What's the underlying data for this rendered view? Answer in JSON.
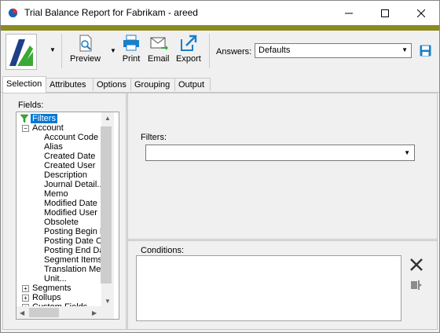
{
  "window": {
    "title": "Trial Balance Report for Fabrikam - areed",
    "controls": [
      "minimize-icon",
      "maximize-icon",
      "close-icon"
    ]
  },
  "toolbar": {
    "preview_label": "Preview",
    "print_label": "Print",
    "email_label": "Email",
    "export_label": "Export",
    "answers_label": "Answers:",
    "answers_value": "Defaults"
  },
  "tabs": [
    {
      "label": "Selection",
      "active": true
    },
    {
      "label": "Attributes"
    },
    {
      "label": "Options"
    },
    {
      "label": "Grouping"
    },
    {
      "label": "Output"
    }
  ],
  "fields": {
    "label": "Fields:",
    "tree": {
      "root": "Filters",
      "account": "Account",
      "account_children": [
        "Account Code",
        "Alias",
        "Created Date",
        "Created User",
        "Description",
        "Journal Detail...",
        "Memo",
        "Modified Date",
        "Modified User",
        "Obsolete",
        "Posting Begin D",
        "Posting Date C",
        "Posting End Da",
        "Segment Items",
        "Translation Me",
        "Unit..."
      ],
      "segments": "Segments",
      "rollups": "Rollups",
      "custom_fields": "Custom Fields"
    }
  },
  "filters": {
    "label": "Filters:",
    "value": ""
  },
  "conditions": {
    "label": "Conditions:"
  },
  "colors": {
    "title_bar": "#ffffff",
    "accent_strip": "#8a8a22",
    "icon_blue": "#1a7fc9",
    "logo_green": "#3aa935",
    "logo_navy": "#1d3f8c",
    "selection": "#0078d7"
  }
}
